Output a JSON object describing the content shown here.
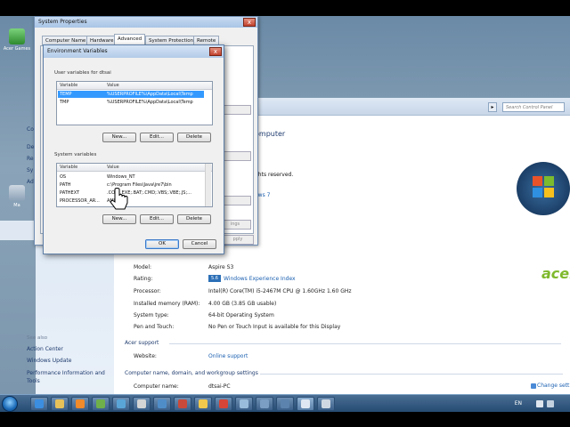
{
  "desktop": {
    "icons": [
      {
        "label": "Acer Games"
      },
      {
        "label": ""
      },
      {
        "label": "Ma"
      }
    ]
  },
  "control_panel": {
    "search_placeholder": "Search Control Panel",
    "left_links": [
      "Co",
      "De",
      "Re",
      "Sy",
      "Ad"
    ],
    "see_also": {
      "heading": "See also",
      "links": [
        "Action Center",
        "Windows Update",
        "Performance Information and Tools"
      ]
    },
    "fragments": {
      "computer": "omputer",
      "rights": "ghts reserved.",
      "windows7": "ows 7"
    },
    "system_rows": [
      {
        "label": "Model:",
        "value": "Aspire S3"
      },
      {
        "label": "Rating:",
        "value": "Windows Experience Index",
        "badge": "5.6"
      },
      {
        "label": "Processor:",
        "value": "Intel(R) Core(TM) i5-2467M CPU @ 1.60GHz   1.60 GHz"
      },
      {
        "label": "Installed memory (RAM):",
        "value": "4.00 GB (3.85 GB usable)"
      },
      {
        "label": "System type:",
        "value": "64-bit Operating System"
      },
      {
        "label": "Pen and Touch:",
        "value": "No Pen or Touch Input is available for this Display"
      }
    ],
    "acer_support": {
      "heading": "Acer support",
      "label": "Website:",
      "value": "Online support"
    },
    "computer_name": {
      "heading": "Computer name, domain, and workgroup settings",
      "label": "Computer name:",
      "value": "dtsai-PC",
      "change": "Change sett"
    },
    "acer_logo": "acer"
  },
  "system_properties": {
    "title": "System Properties",
    "close": "x",
    "tabs": [
      "Computer Name",
      "Hardware",
      "Advanced",
      "System Protection",
      "Remote"
    ],
    "active_tab": "Advanced",
    "faint_button": "pply",
    "faint_button2": "ings"
  },
  "env_vars": {
    "title": "Environment Variables",
    "close": "x",
    "user_group": "User variables for dtsai",
    "system_group": "System variables",
    "col_variable": "Variable",
    "col_value": "Value",
    "user_vars": [
      {
        "name": "TEMP",
        "value": "%USERPROFILE%\\AppData\\Local\\Temp",
        "selected": true
      },
      {
        "name": "TMP",
        "value": "%USERPROFILE%\\AppData\\Local\\Temp",
        "selected": false
      }
    ],
    "system_vars": [
      {
        "name": "OS",
        "value": "Windows_NT"
      },
      {
        "name": "PATH",
        "value": "c:\\Program Files\\Java\\jre7\\bin"
      },
      {
        "name": "PATHEXT",
        "value": ".COM;.EXE;.BAT;.CMD;.VBS;.VBE;.JS;..."
      },
      {
        "name": "PROCESSOR_AR...",
        "value": "AMD64"
      }
    ],
    "buttons": {
      "new": "New...",
      "edit": "Edit...",
      "delete": "Delete",
      "ok": "OK",
      "cancel": "Cancel"
    }
  },
  "taskbar": {
    "language": "EN",
    "time": "",
    "accent": "#254b72"
  }
}
